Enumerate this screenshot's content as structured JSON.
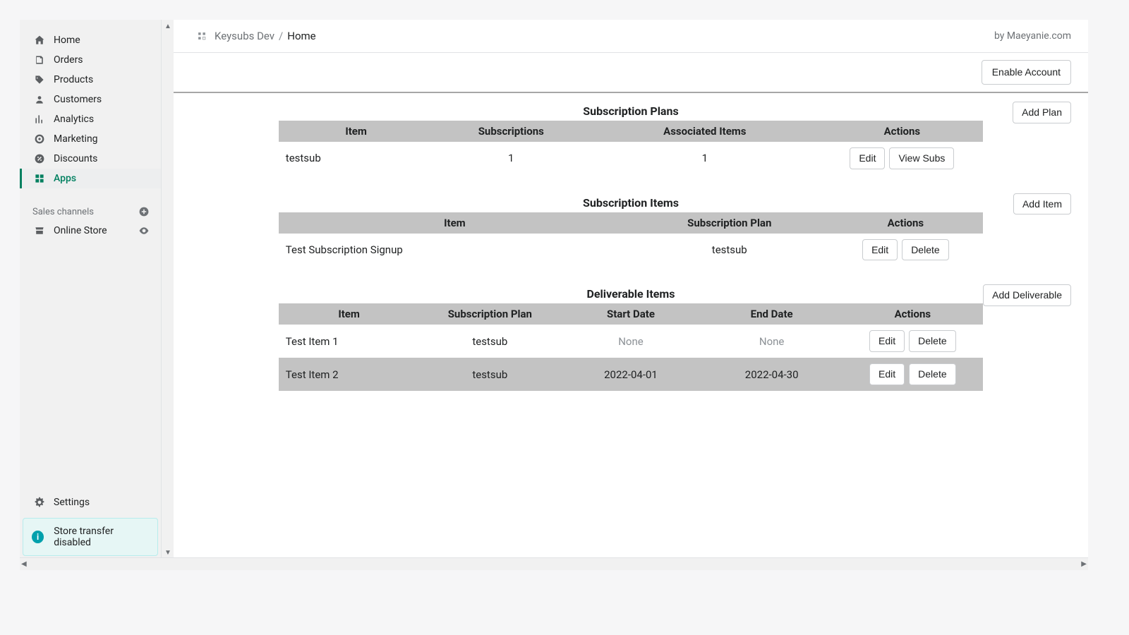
{
  "sidebar": {
    "nav": [
      {
        "label": "Home",
        "icon": "home-icon"
      },
      {
        "label": "Orders",
        "icon": "orders-icon"
      },
      {
        "label": "Products",
        "icon": "products-icon"
      },
      {
        "label": "Customers",
        "icon": "customers-icon"
      },
      {
        "label": "Analytics",
        "icon": "analytics-icon"
      },
      {
        "label": "Marketing",
        "icon": "marketing-icon"
      },
      {
        "label": "Discounts",
        "icon": "discounts-icon"
      },
      {
        "label": "Apps",
        "icon": "apps-icon"
      }
    ],
    "section_header": "Sales channels",
    "channels": [
      {
        "label": "Online Store",
        "icon": "online-store-icon"
      }
    ],
    "settings_label": "Settings",
    "notice": "Store transfer disabled"
  },
  "header": {
    "app_name": "Keysubs Dev",
    "current": "Home",
    "byline": "by Maeyanie.com"
  },
  "top_action": {
    "enable_account": "Enable Account"
  },
  "plans": {
    "title": "Subscription Plans",
    "add_label": "Add Plan",
    "columns": [
      "Item",
      "Subscriptions",
      "Associated Items",
      "Actions"
    ],
    "rows": [
      {
        "item": "testsub",
        "subscriptions": "1",
        "associated": "1",
        "actions": {
          "edit": "Edit",
          "view": "View Subs"
        }
      }
    ]
  },
  "items": {
    "title": "Subscription Items",
    "add_label": "Add Item",
    "columns": [
      "Item",
      "Subscription Plan",
      "Actions"
    ],
    "rows": [
      {
        "item": "Test Subscription Signup",
        "plan": "testsub",
        "actions": {
          "edit": "Edit",
          "delete": "Delete"
        }
      }
    ]
  },
  "deliverables": {
    "title": "Deliverable Items",
    "add_label": "Add Deliverable",
    "columns": [
      "Item",
      "Subscription Plan",
      "Start Date",
      "End Date",
      "Actions"
    ],
    "rows": [
      {
        "item": "Test Item 1",
        "plan": "testsub",
        "start": "None",
        "end": "None",
        "start_muted": true,
        "end_muted": true,
        "actions": {
          "edit": "Edit",
          "delete": "Delete"
        }
      },
      {
        "item": "Test Item 2",
        "plan": "testsub",
        "start": "2022-04-01",
        "end": "2022-04-30",
        "actions": {
          "edit": "Edit",
          "delete": "Delete"
        }
      }
    ]
  }
}
